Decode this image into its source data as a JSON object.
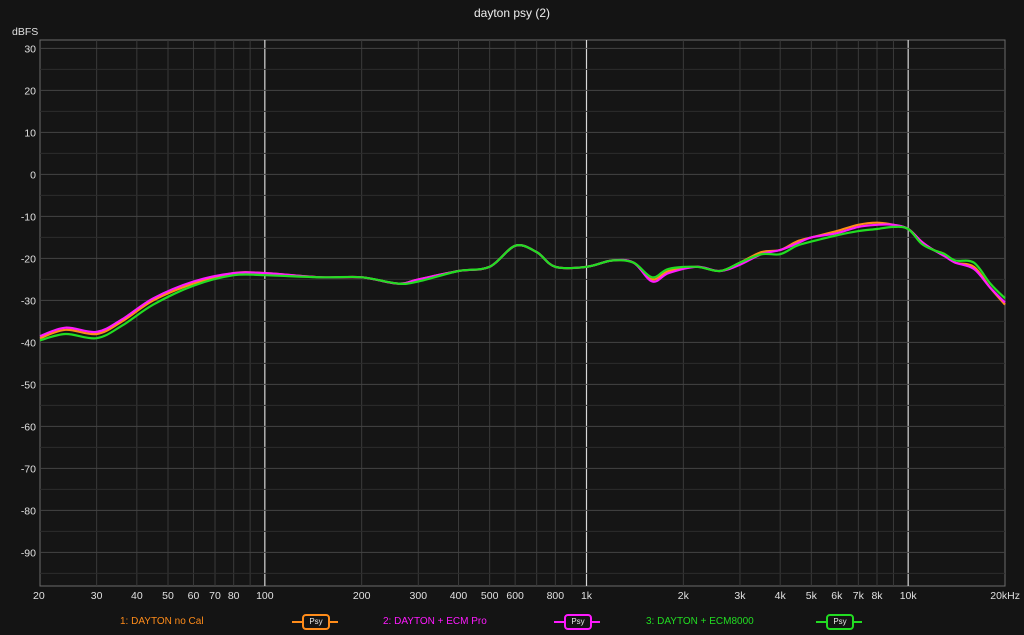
{
  "chart_data": {
    "type": "line",
    "title": "dayton psy (2)",
    "ylabel": "dBFS",
    "xunit": "kHz",
    "xscale": "log",
    "xlim": [
      20,
      20000
    ],
    "ylim": [
      -98,
      32
    ],
    "grid": true,
    "yticks": [
      30,
      20,
      10,
      0,
      -10,
      -20,
      -30,
      -40,
      -50,
      -60,
      -70,
      -80,
      -90
    ],
    "ytick_labels": [
      "30",
      "20",
      "10",
      "0",
      "-10",
      "-20",
      "-30",
      "-40",
      "-50",
      "-60",
      "-70",
      "-80",
      "-90"
    ],
    "xticks": [
      20,
      30,
      40,
      50,
      60,
      70,
      80,
      100,
      200,
      300,
      400,
      500,
      600,
      800,
      1000,
      2000,
      3000,
      4000,
      5000,
      6000,
      7000,
      8000,
      10000,
      20000
    ],
    "xtick_labels": [
      "20",
      "30",
      "40",
      "50",
      "60",
      "70",
      "80",
      "100",
      "200",
      "300",
      "400",
      "500",
      "600",
      "800",
      "1k",
      "2k",
      "3k",
      "4k",
      "5k",
      "6k",
      "7k",
      "8k",
      "10k",
      "20kHz"
    ],
    "legend_placement": "bottom",
    "series": [
      {
        "name": "1: DAYTON no Cal",
        "button": "Psy",
        "color": "#ff8c1a",
        "x": [
          20,
          24,
          30,
          36,
          45,
          60,
          80,
          100,
          150,
          200,
          260,
          300,
          400,
          500,
          600,
          700,
          800,
          1000,
          1200,
          1400,
          1600,
          1800,
          2200,
          2600,
          3000,
          3500,
          4000,
          4500,
          5000,
          6000,
          7000,
          8000,
          9000,
          10000,
          11000,
          12000,
          13000,
          14000,
          16000,
          18000,
          20000
        ],
        "y": [
          -39,
          -37,
          -38,
          -35,
          -30,
          -26,
          -23.5,
          -23.5,
          -24.5,
          -24.5,
          -26,
          -25,
          -23,
          -22,
          -17,
          -18.5,
          -22,
          -22,
          -20.5,
          -21,
          -25,
          -23,
          -22,
          -23,
          -21,
          -18.5,
          -18,
          -16,
          -15,
          -13.5,
          -12,
          -11.5,
          -12,
          -13,
          -16,
          -18,
          -19,
          -21,
          -22,
          -27,
          -31
        ]
      },
      {
        "name": "2: DAYTON + ECM Pro",
        "button": "Psy",
        "color": "#ff1aff",
        "x": [
          20,
          24,
          30,
          36,
          45,
          60,
          80,
          100,
          150,
          200,
          260,
          300,
          400,
          500,
          600,
          700,
          800,
          1000,
          1200,
          1400,
          1600,
          1800,
          2200,
          2600,
          3000,
          3500,
          4000,
          4500,
          5000,
          6000,
          7000,
          8000,
          9000,
          10000,
          11000,
          12000,
          13000,
          14000,
          16000,
          18000,
          20000
        ],
        "y": [
          -38.5,
          -36.5,
          -37.5,
          -34.5,
          -29.5,
          -25.5,
          -23.5,
          -23.5,
          -24.5,
          -24.5,
          -26,
          -25,
          -23,
          -22,
          -17,
          -18.5,
          -22,
          -22,
          -20.5,
          -21,
          -25.5,
          -23.5,
          -22,
          -23,
          -21.5,
          -19,
          -18,
          -16.5,
          -15,
          -14,
          -12.5,
          -12,
          -12,
          -13,
          -16,
          -18,
          -19.5,
          -21,
          -22.5,
          -27,
          -30.5
        ]
      },
      {
        "name": "3: DAYTON + ECM8000",
        "button": "Psy",
        "color": "#22dd22",
        "x": [
          20,
          24,
          30,
          36,
          45,
          60,
          80,
          100,
          150,
          200,
          260,
          300,
          400,
          500,
          600,
          700,
          800,
          1000,
          1200,
          1400,
          1600,
          1800,
          2200,
          2600,
          3000,
          3500,
          4000,
          4500,
          5000,
          6000,
          7000,
          8000,
          9000,
          10000,
          11000,
          12000,
          13000,
          14000,
          16000,
          18000,
          20000
        ],
        "y": [
          -39.5,
          -38,
          -39,
          -36,
          -31,
          -26.5,
          -24,
          -24,
          -24.5,
          -24.5,
          -26,
          -25.5,
          -23,
          -22,
          -17,
          -18.5,
          -22,
          -22,
          -20.5,
          -21,
          -24.5,
          -22.5,
          -22,
          -23,
          -21,
          -19,
          -19,
          -17,
          -16,
          -14.5,
          -13.5,
          -13,
          -12.5,
          -13,
          -16.5,
          -18,
          -19,
          -20.5,
          -21,
          -26,
          -29.5
        ]
      }
    ]
  }
}
